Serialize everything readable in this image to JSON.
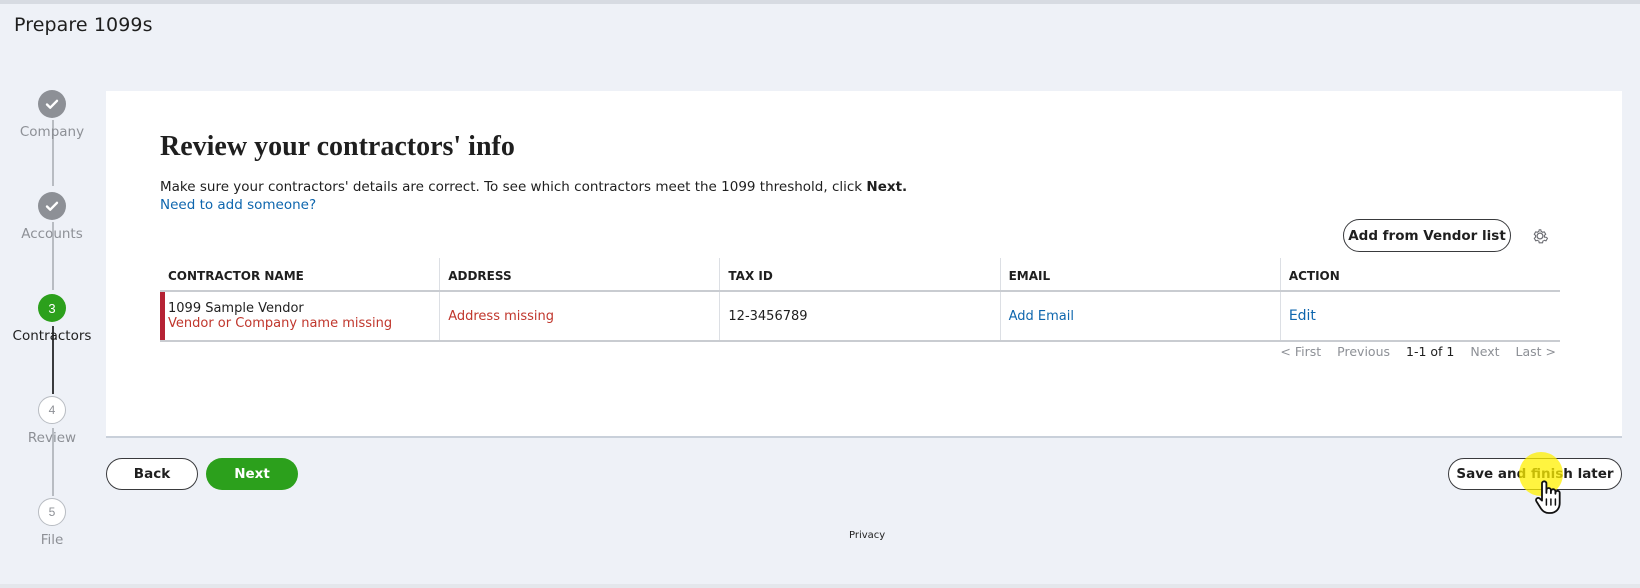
{
  "header": {
    "title": "Prepare 1099s"
  },
  "stepper": {
    "steps": [
      {
        "label": "Company",
        "status": "done",
        "number": "1"
      },
      {
        "label": "Accounts",
        "status": "done",
        "number": "2"
      },
      {
        "label": "Contractors",
        "status": "active",
        "number": "3"
      },
      {
        "label": "Review",
        "status": "todo",
        "number": "4"
      },
      {
        "label": "File",
        "status": "todo",
        "number": "5"
      }
    ]
  },
  "main": {
    "title": "Review your contractors' info",
    "subtext_prefix": "Make sure your contractors' details are correct. To see which contractors meet the 1099 threshold, click ",
    "subtext_bold": "Next.",
    "add_link": "Need to add someone?",
    "vendor_button": "Add from Vendor list",
    "table": {
      "headers": [
        "CONTRACTOR NAME",
        "ADDRESS",
        "TAX ID",
        "EMAIL",
        "ACTION"
      ],
      "rows": [
        {
          "name": "1099 Sample Vendor",
          "name_error": "Vendor or Company name missing",
          "address": "Address missing",
          "tax_id": "12-3456789",
          "email": "Add Email",
          "action": "Edit"
        }
      ]
    },
    "pager": {
      "first": "< First",
      "previous": "Previous",
      "range": "1-1 of 1",
      "next": "Next",
      "last": "Last >"
    }
  },
  "footer": {
    "back": "Back",
    "next": "Next",
    "save": "Save and finish later",
    "privacy": "Privacy"
  },
  "colors": {
    "accent_green": "#2ca01c",
    "link_blue": "#0e66ae",
    "error_red": "#c0362c",
    "error_bar": "#b52234"
  }
}
